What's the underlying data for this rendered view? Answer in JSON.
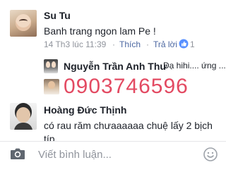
{
  "comments": [
    {
      "author": "Su Tu",
      "text": "Banh trang ngon lam Pe !",
      "time": "14 Th3 lúc 11:39",
      "like_label": "Thích",
      "reply_label": "Trả lời",
      "like_count": "1"
    },
    {
      "author": "Hoàng Đức Thịnh",
      "text_line1": "có rau răm chưaaaaaa chuệ lấy 2 bịch",
      "text_line2": "típ"
    }
  ],
  "reply": {
    "author": "Nguyễn Trần Anh Thư",
    "preview": "Dạ hihi.... ứng ..."
  },
  "overlay_phone": "0903746596",
  "composer": {
    "placeholder": "Viết bình luận...",
    "camera_icon": "camera-icon",
    "emoji_icon": "smile-icon"
  },
  "colors": {
    "link": "#4b67a1",
    "meta": "#90949c",
    "phone": "#e34a62",
    "text": "#1d2129"
  }
}
